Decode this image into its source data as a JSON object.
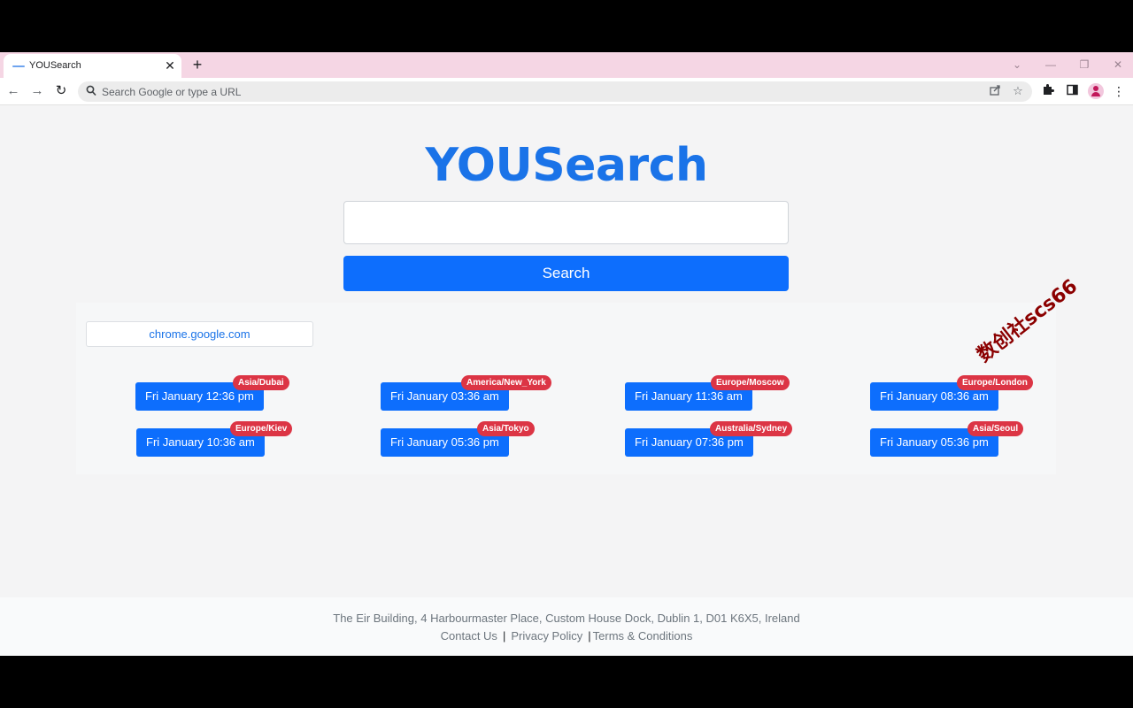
{
  "browser": {
    "tab_title": "YOUSearch",
    "tab_close": "✕",
    "new_tab": "+",
    "window_controls": [
      "⌄",
      "—",
      "❐",
      "✕"
    ],
    "nav": {
      "back": "←",
      "forward": "→",
      "reload": "↻"
    },
    "omnibox_placeholder": "Search Google or type a URL",
    "icons": [
      "share-icon",
      "star-icon",
      "extensions-icon",
      "side-panel-icon",
      "profile-avatar",
      "menu-icon"
    ]
  },
  "page": {
    "logo": "YOUSearch",
    "search_button": "Search",
    "shortcut": "chrome.google.com",
    "watermark": "数创社scs66",
    "clocks": [
      {
        "time": "Fri January 12:36 pm",
        "zone": "Asia/Dubai"
      },
      {
        "time": "Fri January 03:36 am",
        "zone": "America/New_York"
      },
      {
        "time": "Fri January 11:36 am",
        "zone": "Europe/Moscow"
      },
      {
        "time": "Fri January 08:36 am",
        "zone": "Europe/London"
      },
      {
        "time": "Fri January 10:36 am",
        "zone": "Europe/Kiev"
      },
      {
        "time": "Fri January 05:36 pm",
        "zone": "Asia/Tokyo"
      },
      {
        "time": "Fri January 07:36 pm",
        "zone": "Australia/Sydney"
      },
      {
        "time": "Fri January 05:36 pm",
        "zone": "Asia/Seoul"
      }
    ],
    "colors": {
      "primary": "#0d6efd",
      "badge": "#dc3545",
      "logo": "#1a73e8"
    }
  },
  "footer": {
    "address": "The Eir Building, 4 Harbourmaster Place, Custom House Dock, Dublin 1, D01 K6X5, Ireland",
    "links": [
      "Contact Us",
      "Privacy Policy",
      "Terms & Conditions"
    ],
    "separator": "|"
  }
}
